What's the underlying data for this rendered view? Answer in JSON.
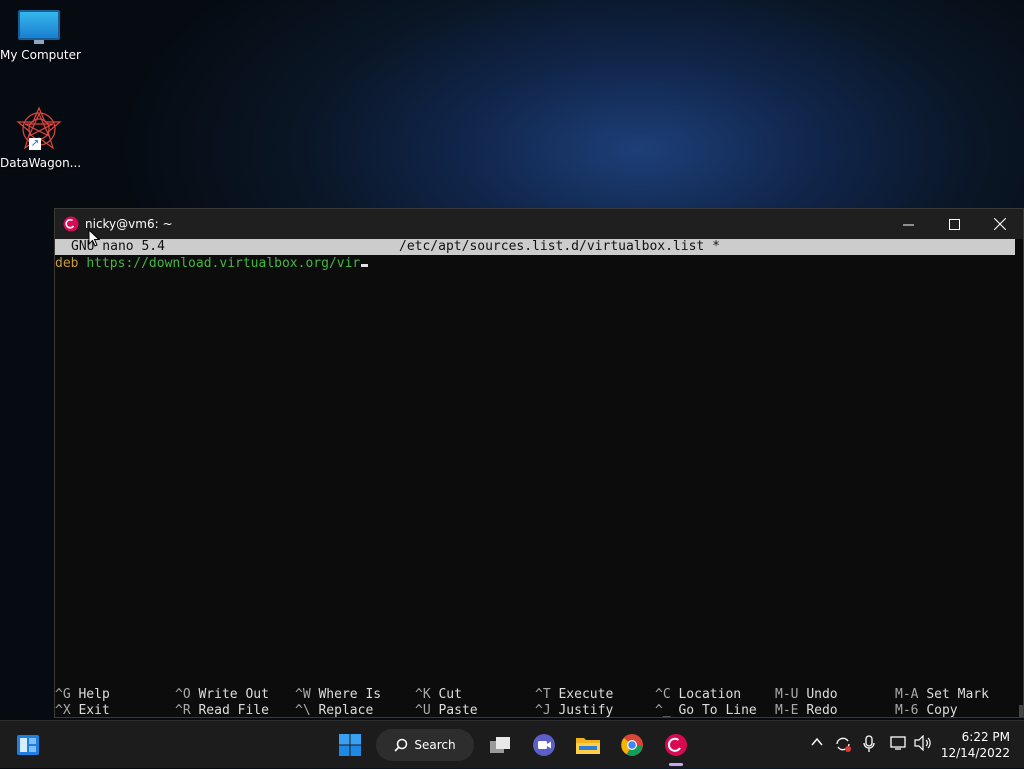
{
  "desktop": {
    "icons": [
      {
        "label": "My Computer"
      },
      {
        "label": "DataWagon..."
      }
    ]
  },
  "terminal": {
    "title": "nicky@vm6: ~",
    "nano": {
      "version": "GNU nano 5.4",
      "filename": "/etc/apt/sources.list.d/virtualbox.list *",
      "line_keyword": "deb ",
      "line_url": "https://download.virtualbox.org/vir"
    },
    "shortcuts": [
      {
        "key": "^G",
        "label": "Help"
      },
      {
        "key": "^X",
        "label": "Exit"
      },
      {
        "key": "^O",
        "label": "Write Out"
      },
      {
        "key": "^R",
        "label": "Read File"
      },
      {
        "key": "^W",
        "label": "Where Is"
      },
      {
        "key": "^\\",
        "label": "Replace"
      },
      {
        "key": "^K",
        "label": "Cut"
      },
      {
        "key": "^U",
        "label": "Paste"
      },
      {
        "key": "^T",
        "label": "Execute"
      },
      {
        "key": "^J",
        "label": "Justify"
      },
      {
        "key": "^C",
        "label": "Location"
      },
      {
        "key": "^_",
        "label": "Go To Line"
      },
      {
        "key": "M-U",
        "label": "Undo"
      },
      {
        "key": "M-E",
        "label": "Redo"
      },
      {
        "key": "M-A",
        "label": "Set Mark"
      },
      {
        "key": "M-6",
        "label": "Copy"
      }
    ]
  },
  "taskbar": {
    "search_label": "Search",
    "clock": {
      "time": "6:22 PM",
      "date": "12/14/2022"
    },
    "pinned": [
      "widgets-icon",
      "start-icon",
      "task-view-icon",
      "meet-icon",
      "file-explorer-icon",
      "chrome-icon",
      "debian-terminal-icon"
    ]
  },
  "colors": {
    "nano_header_bg": "#cccccc",
    "syntax_keyword": "#c59a3a",
    "syntax_url": "#3fb83f",
    "taskbar_bg": "#1c1c1c"
  }
}
